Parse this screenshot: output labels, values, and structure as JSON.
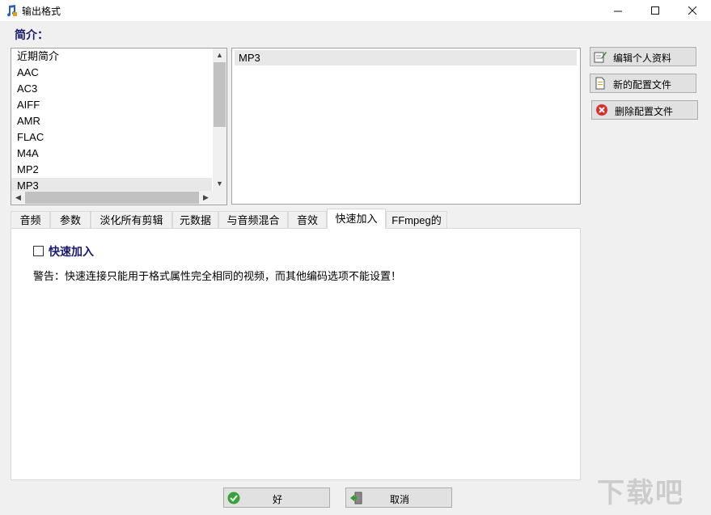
{
  "window": {
    "title": "输出格式"
  },
  "profiles": {
    "label": "简介：",
    "items": [
      "近期简介",
      "AAC",
      "AC3",
      "AIFF",
      "AMR",
      "FLAC",
      "M4A",
      "MP2",
      "MP3"
    ],
    "selected": "MP3"
  },
  "details": {
    "selected_name": "MP3"
  },
  "side_buttons": {
    "edit": "编辑个人资料",
    "new": "新的配置文件",
    "delete": "删除配置文件"
  },
  "tabs": [
    "音频",
    "参数",
    "淡化所有剪辑",
    "元数据",
    "与音频混合",
    "音效",
    "快速加入",
    "FFmpeg的"
  ],
  "active_tab": "快速加入",
  "quick_join": {
    "checkbox_label": "快速加入",
    "warning": "警告：快速连接只能用于格式属性完全相同的视频，而其他编码选项不能设置！"
  },
  "bottom_buttons": {
    "ok": "好",
    "cancel": "取消"
  },
  "colors": {
    "accent_text": "#1a1a6a",
    "selection": "#e8e8e8"
  }
}
